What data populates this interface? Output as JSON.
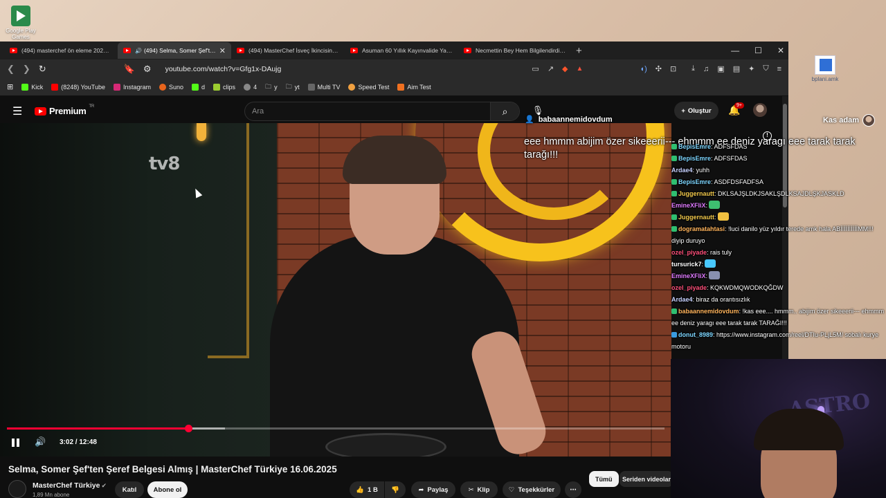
{
  "desktop": {
    "icon_google_play": "Google Play Games",
    "icon_file": "bplani.amk"
  },
  "browser": {
    "tabs": [
      {
        "label": "(494) masterchef ön eleme 2025 - Yo",
        "active": false
      },
      {
        "label": "(494) Selma, Somer Şef'ten Ş",
        "active": true
      },
      {
        "label": "(494) MasterChef İsveç İkincisine Kap",
        "active": false
      },
      {
        "label": "Asuman 60 Yıllık Kayınvalide Yadigar",
        "active": false
      },
      {
        "label": "Necmettin Bey Hem Bilgilendirdi Hem",
        "active": false
      }
    ],
    "url": "youtube.com/watch?v=Gfg1x-DAujg",
    "bookmarks": [
      {
        "label": "Kick",
        "color": "#53fc18"
      },
      {
        "label": "(8248) YouTube",
        "color": "#ff0000"
      },
      {
        "label": "Instagram",
        "color": "#d62976"
      },
      {
        "label": "Suno",
        "color": "#e8641c"
      },
      {
        "label": "d",
        "color": "#53fc18"
      },
      {
        "label": "clips",
        "color": "#9ccc30"
      },
      {
        "label": "4",
        "color": "#888888"
      },
      {
        "label": "y",
        "color": "#bbbbbb"
      },
      {
        "label": "yt",
        "color": "#bbbbbb"
      },
      {
        "label": "Multi TV",
        "color": "#666666"
      },
      {
        "label": "Speed Test",
        "color": "#f0a040"
      },
      {
        "label": "Aim Test",
        "color": "#f07020"
      }
    ]
  },
  "youtube": {
    "logo": "Premium",
    "logo_region": "TR",
    "search_placeholder": "Ara",
    "create_label": "Oluştur",
    "notif_count": "9+",
    "video": {
      "watermark": "tv8",
      "time": "3:02 / 12:48",
      "progress_fraction": 0.276,
      "buffered_fraction": 0.332
    },
    "title": "Selma, Somer Şef'ten Şeref Belgesi Almış | MasterChef Türkiye 16.06.2025",
    "channel": "MasterChef Türkiye",
    "subs": "1,89 Mn abone",
    "join": "Katıl",
    "subscribe": "Abone ol",
    "likes": "1 B",
    "share": "Paylaş",
    "clip": "Klip",
    "thanks": "Teşekkürler",
    "more": "⋯",
    "chips": [
      "Tümü",
      "Seriden videolar"
    ]
  },
  "overlay": {
    "tts_user": "babaannemidovdum",
    "tts_message": "eee hmmm abijim özer sikeeerii--- ehmmm ee deniz yaragı eee tarak tarak tarağı!!!",
    "streamer": "Kas adam",
    "chat": [
      {
        "user": "BepisEmre",
        "msg": ": ADFSFDAS",
        "color": "#7dd6ff",
        "badge": "#2fbf71"
      },
      {
        "user": "BepisEmre",
        "msg": ": ADFSFDAS",
        "color": "#7dd6ff",
        "badge": "#2fbf71"
      },
      {
        "user": "Ardae4",
        "msg": ": yuhh",
        "color": "#c7d2ff",
        "badge": ""
      },
      {
        "user": "BepisEmre",
        "msg": ": ASDFDSFADFSA",
        "color": "#7dd6ff",
        "badge": "#2fbf71"
      },
      {
        "user": "Juggernautt",
        "msg": ": DKLSAJŞLDKJSAKLŞDLKSAJDLŞKJASKLD",
        "color": "#f2c94c",
        "badge": "#2fbf71"
      },
      {
        "user": "EmineXFliX",
        "msg": ":",
        "color": "#e07bff",
        "badge": "",
        "emote": "#3ec070"
      },
      {
        "user": "Juggernautt",
        "msg": ":",
        "color": "#f2c94c",
        "badge": "#2fbf71",
        "emote": "#f0c040"
      },
      {
        "user": "dogramatahtasi",
        "msg": ": !luci danilo yüz yıldır terede amk hala ABİİİİİİİİİİMM!!! diyip duruyo",
        "color": "#ffb45c",
        "badge": "#2fbf71"
      },
      {
        "user": "ozel_piyade",
        "msg": ": rais tuly",
        "color": "#ff4f7a",
        "badge": ""
      },
      {
        "user": "tursurick7",
        "msg": ":",
        "color": "#ffffff",
        "badge": "",
        "emote": "#48c8ff"
      },
      {
        "user": "EmineXFliX",
        "msg": ":",
        "color": "#e07bff",
        "badge": "",
        "emote": "#8890b0"
      },
      {
        "user": "ozel_piyade",
        "msg": ": KQKWDMQWODKQĞDW",
        "color": "#ff4f7a",
        "badge": ""
      },
      {
        "user": "Ardae4",
        "msg": ": biraz da orantısızlık",
        "color": "#c7d2ff",
        "badge": ""
      },
      {
        "user": "babaannemidovdum",
        "msg": ": !kas eee.... hmmm.. abijim özer sikeeerii--- ehmmm ee deniz yaragı eee tarak tarak TARAĞI!!!",
        "color": "#ffb45c",
        "badge": "#2fbf71"
      },
      {
        "user": "donut_8989",
        "msg": ": https://www.instagram.com/reel/DTIu-PLjL5M/ sobalı kurye motoru",
        "color": "#7dd6ff",
        "badge": "#3a9be0"
      }
    ]
  }
}
